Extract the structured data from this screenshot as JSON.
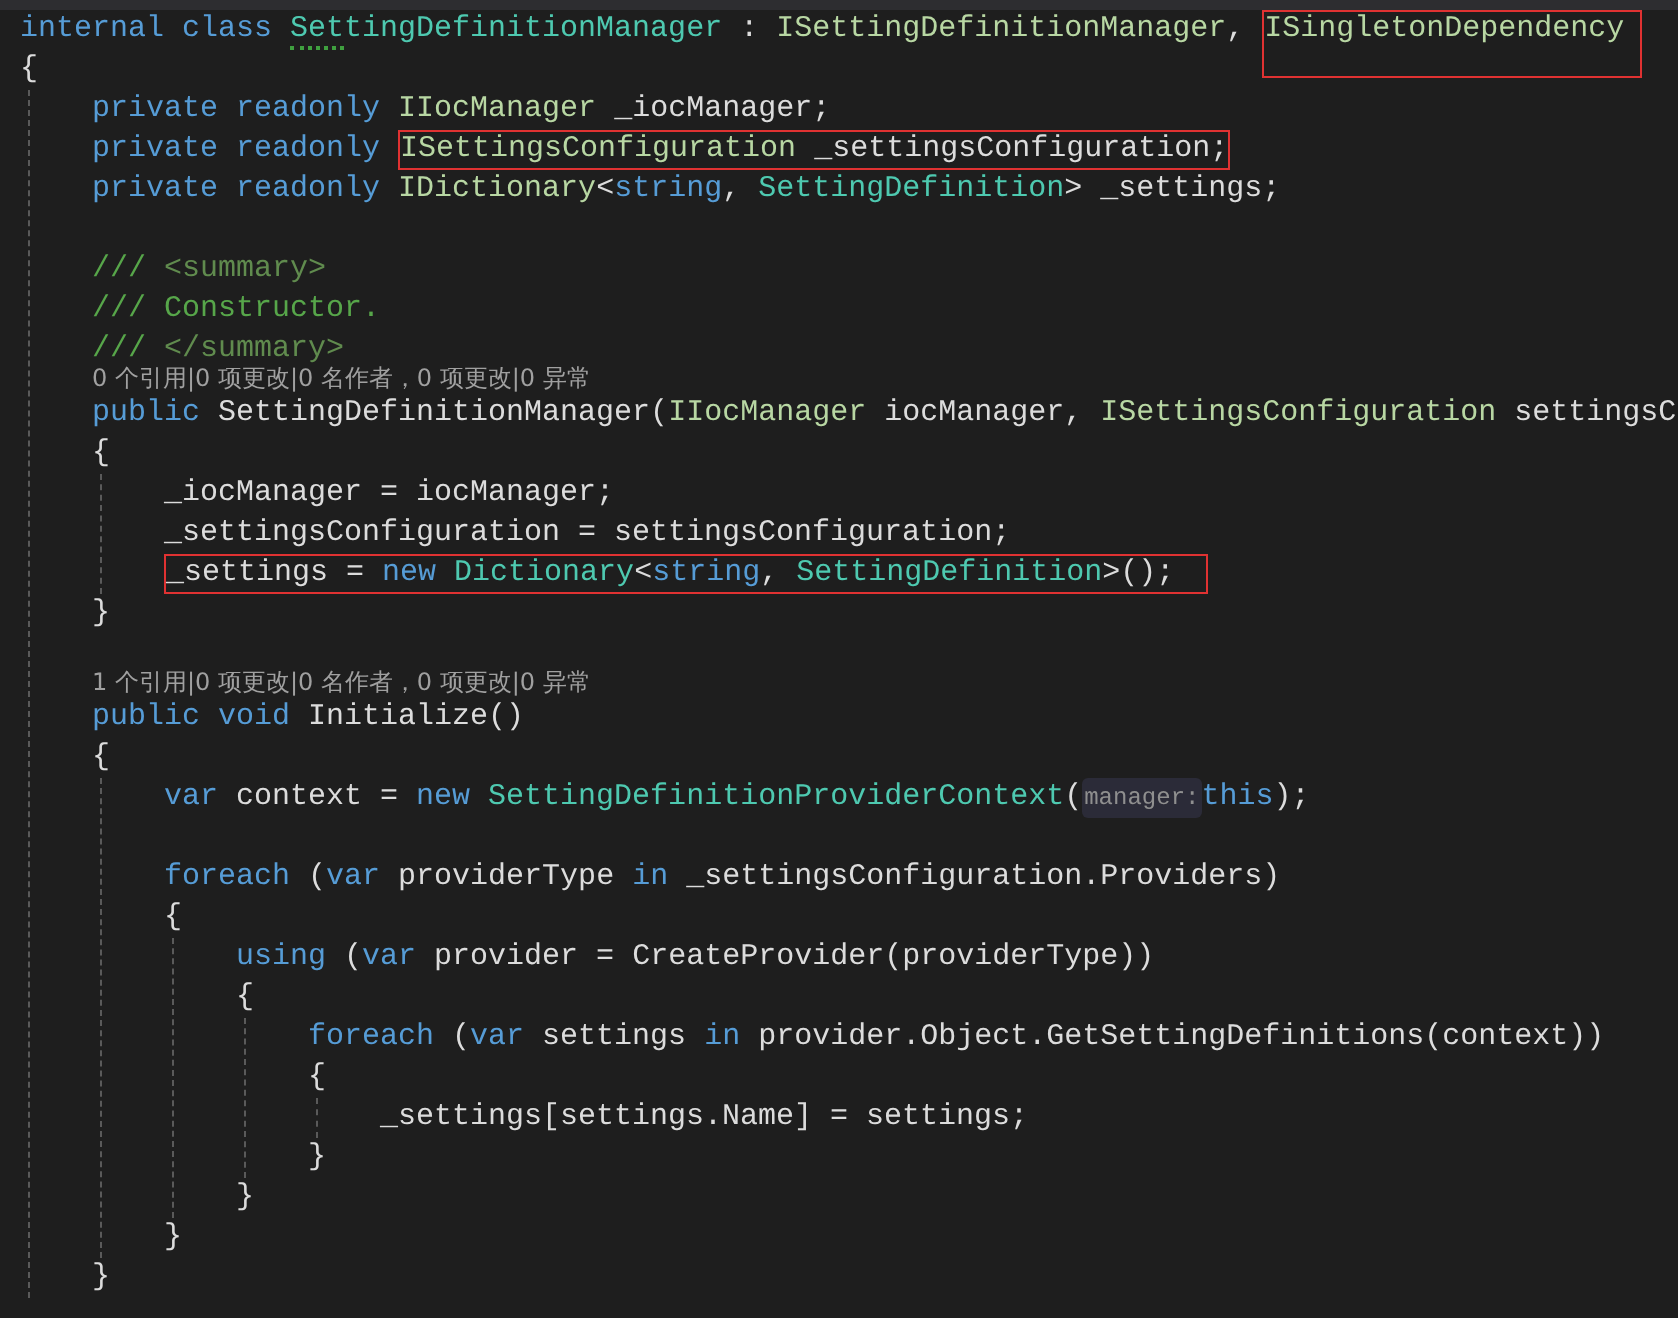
{
  "lines": [
    {
      "kind": "code",
      "tokens": [
        {
          "kind": "kw",
          "t": "internal class "
        },
        {
          "kind": "type",
          "t": "SettingDefinitionManager",
          "squiggle": true
        },
        {
          "kind": "plain",
          "t": " : "
        },
        {
          "kind": "iface",
          "t": "ISettingDefinitionManager"
        },
        {
          "kind": "plain",
          "t": ", "
        },
        {
          "kind": "box",
          "tokens": [
            {
              "kind": "iface",
              "t": "ISingletonDependency"
            }
          ]
        }
      ]
    },
    {
      "kind": "code",
      "tokens": [
        {
          "kind": "plain",
          "t": "{"
        }
      ],
      "children": [
        {
          "kind": "code",
          "tokens": [
            {
              "kind": "kw",
              "t": "private readonly "
            },
            {
              "kind": "iface",
              "t": "IIocManager"
            },
            {
              "kind": "plain",
              "t": " _iocManager;"
            }
          ]
        },
        {
          "kind": "code",
          "tokens": [
            {
              "kind": "kw",
              "t": "private readonly "
            },
            {
              "kind": "box",
              "tokens": [
                {
                  "kind": "iface",
                  "t": "ISettingsConfiguration"
                },
                {
                  "kind": "plain",
                  "t": " _settingsConfiguration;"
                }
              ]
            }
          ]
        },
        {
          "kind": "code",
          "tokens": [
            {
              "kind": "kw",
              "t": "private readonly "
            },
            {
              "kind": "iface",
              "t": "IDictionary"
            },
            {
              "kind": "plain",
              "t": "<"
            },
            {
              "kind": "kw",
              "t": "string"
            },
            {
              "kind": "plain",
              "t": ", "
            },
            {
              "kind": "type",
              "t": "SettingDefinition"
            },
            {
              "kind": "plain",
              "t": "> _settings;"
            }
          ]
        },
        {
          "kind": "blank"
        },
        {
          "kind": "code",
          "tokens": [
            {
              "kind": "comment",
              "t": "/// "
            },
            {
              "kind": "doctag",
              "t": "<summary>"
            }
          ]
        },
        {
          "kind": "code",
          "tokens": [
            {
              "kind": "comment",
              "t": "/// Constructor."
            }
          ]
        },
        {
          "kind": "code",
          "tokens": [
            {
              "kind": "comment",
              "t": "/// "
            },
            {
              "kind": "doctag",
              "t": "</summary>"
            }
          ]
        },
        {
          "kind": "codelens",
          "tokens": [
            {
              "kind": "lens",
              "t": "0 个引用|0 项更改|0 名作者，0 项更改|0 异常"
            }
          ]
        },
        {
          "kind": "code",
          "tokens": [
            {
              "kind": "kw",
              "t": "public "
            },
            {
              "kind": "plain",
              "t": "SettingDefinitionManager("
            },
            {
              "kind": "iface",
              "t": "IIocManager"
            },
            {
              "kind": "plain",
              "t": " iocManager, "
            },
            {
              "kind": "iface",
              "t": "ISettingsConfiguration"
            },
            {
              "kind": "plain",
              "t": " settingsC"
            }
          ]
        },
        {
          "kind": "code",
          "tokens": [
            {
              "kind": "plain",
              "t": "{"
            }
          ],
          "children": [
            {
              "kind": "code",
              "tokens": [
                {
                  "kind": "plain",
                  "t": "_iocManager = iocManager;"
                }
              ]
            },
            {
              "kind": "code",
              "tokens": [
                {
                  "kind": "plain",
                  "t": "_settingsConfiguration = settingsConfiguration;"
                }
              ]
            },
            {
              "kind": "code",
              "tokens": [
                {
                  "kind": "box",
                  "tokens": [
                    {
                      "kind": "plain",
                      "t": "_settings = "
                    },
                    {
                      "kind": "kw",
                      "t": "new "
                    },
                    {
                      "kind": "type",
                      "t": "Dictionary"
                    },
                    {
                      "kind": "plain",
                      "t": "<"
                    },
                    {
                      "kind": "kw",
                      "t": "string"
                    },
                    {
                      "kind": "plain",
                      "t": ", "
                    },
                    {
                      "kind": "type",
                      "t": "SettingDefinition"
                    },
                    {
                      "kind": "plain",
                      "t": ">();"
                    }
                  ]
                }
              ]
            }
          ]
        },
        {
          "kind": "code",
          "tokens": [
            {
              "kind": "plain",
              "t": "}"
            }
          ]
        },
        {
          "kind": "blank"
        },
        {
          "kind": "codelens",
          "tokens": [
            {
              "kind": "lens",
              "t": "1 个引用|0 项更改|0 名作者，0 项更改|0 异常"
            }
          ]
        },
        {
          "kind": "code",
          "tokens": [
            {
              "kind": "kw",
              "t": "public void "
            },
            {
              "kind": "plain",
              "t": "Initialize()"
            }
          ]
        },
        {
          "kind": "code",
          "tokens": [
            {
              "kind": "plain",
              "t": "{"
            }
          ],
          "children": [
            {
              "kind": "code",
              "tokens": [
                {
                  "kind": "kw",
                  "t": "var "
                },
                {
                  "kind": "plain",
                  "t": "context = "
                },
                {
                  "kind": "kw",
                  "t": "new "
                },
                {
                  "kind": "type",
                  "t": "SettingDefinitionProviderContext"
                },
                {
                  "kind": "plain",
                  "t": "("
                },
                {
                  "kind": "hint",
                  "t": "manager:"
                },
                {
                  "kind": "kw",
                  "t": "this"
                },
                {
                  "kind": "plain",
                  "t": ");"
                }
              ]
            },
            {
              "kind": "blank"
            },
            {
              "kind": "code",
              "tokens": [
                {
                  "kind": "kw",
                  "t": "foreach "
                },
                {
                  "kind": "plain",
                  "t": "("
                },
                {
                  "kind": "kw",
                  "t": "var "
                },
                {
                  "kind": "plain",
                  "t": "providerType "
                },
                {
                  "kind": "kw",
                  "t": "in "
                },
                {
                  "kind": "plain",
                  "t": "_settingsConfiguration.Providers)"
                }
              ]
            },
            {
              "kind": "code",
              "tokens": [
                {
                  "kind": "plain",
                  "t": "{"
                }
              ],
              "children": [
                {
                  "kind": "code",
                  "tokens": [
                    {
                      "kind": "kw",
                      "t": "using "
                    },
                    {
                      "kind": "plain",
                      "t": "("
                    },
                    {
                      "kind": "kw",
                      "t": "var "
                    },
                    {
                      "kind": "plain",
                      "t": "provider = CreateProvider(providerType))"
                    }
                  ]
                },
                {
                  "kind": "code",
                  "tokens": [
                    {
                      "kind": "plain",
                      "t": "{"
                    }
                  ],
                  "children": [
                    {
                      "kind": "code",
                      "tokens": [
                        {
                          "kind": "kw",
                          "t": "foreach "
                        },
                        {
                          "kind": "plain",
                          "t": "("
                        },
                        {
                          "kind": "kw",
                          "t": "var "
                        },
                        {
                          "kind": "plain",
                          "t": "settings "
                        },
                        {
                          "kind": "kw",
                          "t": "in "
                        },
                        {
                          "kind": "plain",
                          "t": "provider.Object.GetSettingDefinitions(context))"
                        }
                      ]
                    },
                    {
                      "kind": "code",
                      "tokens": [
                        {
                          "kind": "plain",
                          "t": "{"
                        }
                      ],
                      "children": [
                        {
                          "kind": "code",
                          "tokens": [
                            {
                              "kind": "plain",
                              "t": "_settings[settings.Name] = settings;"
                            }
                          ]
                        }
                      ]
                    },
                    {
                      "kind": "code",
                      "tokens": [
                        {
                          "kind": "plain",
                          "t": "}"
                        }
                      ]
                    }
                  ]
                },
                {
                  "kind": "code",
                  "tokens": [
                    {
                      "kind": "plain",
                      "t": "}"
                    }
                  ]
                }
              ]
            },
            {
              "kind": "code",
              "tokens": [
                {
                  "kind": "plain",
                  "t": "}"
                }
              ]
            }
          ]
        },
        {
          "kind": "code",
          "tokens": [
            {
              "kind": "plain",
              "t": "}"
            }
          ]
        }
      ]
    }
  ]
}
